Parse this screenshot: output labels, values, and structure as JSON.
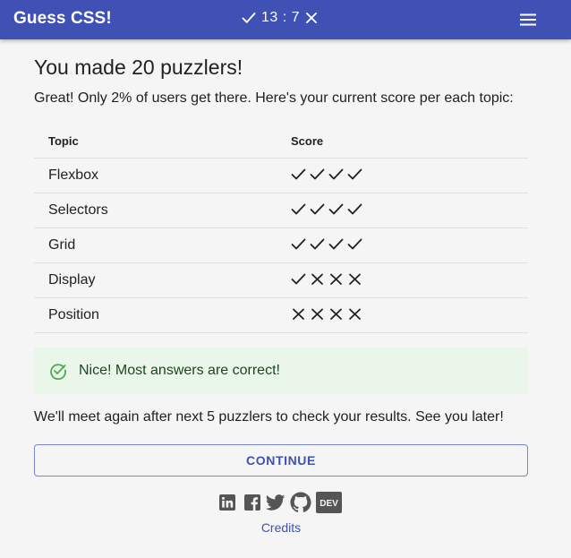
{
  "appbar": {
    "title": "Guess CSS!",
    "score": {
      "correct_icon": "check-icon",
      "text": "13 : 7",
      "wrong_icon": "cross-icon"
    },
    "menu_icon": "hamburger-menu-icon",
    "background_color": "#3f51b5"
  },
  "main": {
    "heading": "You made 20 puzzlers!",
    "subtitle": "Great! Only 2% of users get there. Here's your current score per each topic:",
    "table": {
      "columns": [
        "Topic",
        "Score"
      ],
      "rows": [
        {
          "topic": "Flexbox",
          "score": [
            "correct",
            "correct",
            "correct",
            "correct"
          ]
        },
        {
          "topic": "Selectors",
          "score": [
            "correct",
            "correct",
            "correct",
            "correct"
          ]
        },
        {
          "topic": "Grid",
          "score": [
            "correct",
            "correct",
            "correct",
            "correct"
          ]
        },
        {
          "topic": "Display",
          "score": [
            "correct",
            "wrong",
            "wrong",
            "wrong"
          ]
        },
        {
          "topic": "Position",
          "score": [
            "wrong",
            "wrong",
            "wrong",
            "wrong"
          ]
        }
      ]
    },
    "alert": {
      "icon": "check-circle-icon",
      "text": "Nice! Most answers are correct!",
      "color": "#4caf50"
    },
    "message": "We'll meet again after next 5 puzzlers to check your results. See you later!",
    "continue_label": "CONTINUE"
  },
  "footer": {
    "social": [
      {
        "name": "linkedin",
        "icon": "linkedin-icon"
      },
      {
        "name": "facebook",
        "icon": "facebook-icon"
      },
      {
        "name": "twitter",
        "icon": "twitter-icon"
      },
      {
        "name": "github",
        "icon": "github-icon"
      },
      {
        "name": "dev",
        "icon": "dev-icon",
        "label": "DEV"
      }
    ],
    "credits_label": "Credits",
    "link_color": "#3f51b5"
  }
}
